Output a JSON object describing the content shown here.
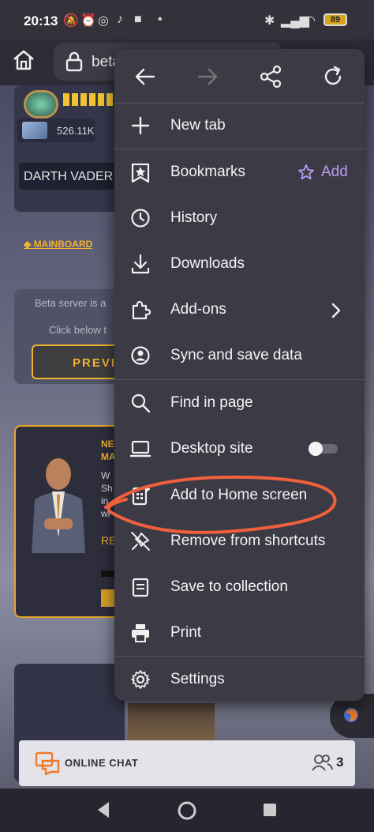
{
  "status_bar": {
    "time": "20:13",
    "battery": "89"
  },
  "browser": {
    "url_text": "beta"
  },
  "page": {
    "player_cash": "526.11K",
    "player_name": "DARTH VADER",
    "mainboard_link": "◆ MAINBOARD",
    "beta_line1": "Beta server is a",
    "beta_line2": "Click below t",
    "preview_button": "PREVI",
    "news_heading": "NE\nMA",
    "news_body": "W\nSh\nin\nwi",
    "news_read": "RE",
    "chat_label": "ONLINE CHAT",
    "chat_count": "3"
  },
  "menu": {
    "items": [
      {
        "label": "New tab",
        "icon": "plus-icon"
      },
      {
        "label": "Bookmarks",
        "icon": "star-list-icon"
      },
      {
        "label": "History",
        "icon": "clock-icon"
      },
      {
        "label": "Downloads",
        "icon": "download-icon"
      },
      {
        "label": "Add-ons",
        "icon": "puzzle-icon"
      },
      {
        "label": "Sync and save data",
        "icon": "account-icon"
      },
      {
        "label": "Find in page",
        "icon": "search-icon"
      },
      {
        "label": "Desktop site",
        "icon": "laptop-icon"
      },
      {
        "label": "Add to Home screen",
        "icon": "add-to-home-icon"
      },
      {
        "label": "Remove from shortcuts",
        "icon": "unpin-icon"
      },
      {
        "label": "Save to collection",
        "icon": "collection-icon"
      },
      {
        "label": "Print",
        "icon": "printer-icon"
      },
      {
        "label": "Settings",
        "icon": "gear-icon"
      }
    ],
    "bookmark_add_label": "Add",
    "desktop_site_enabled": false
  },
  "colors": {
    "accent_purple": "#b99cf5",
    "annotation_orange": "#f0603a",
    "game_gold": "#f2b230"
  }
}
